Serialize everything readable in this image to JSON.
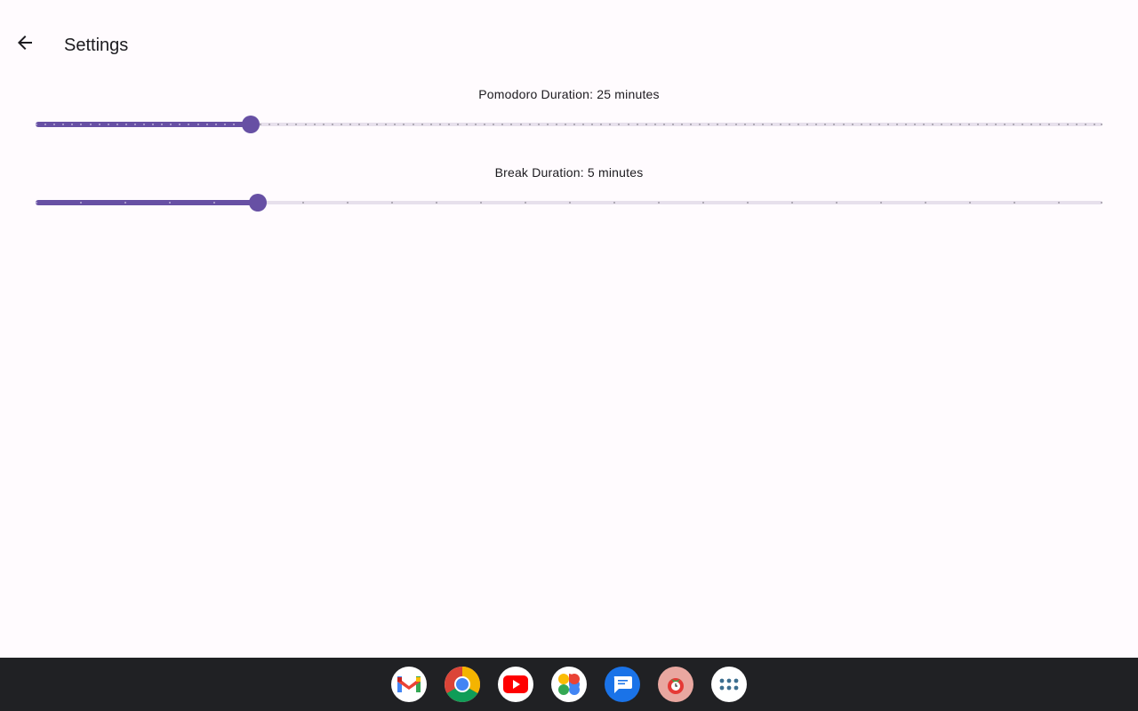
{
  "header": {
    "title": "Settings",
    "back_icon": "arrow-back-icon"
  },
  "settings": {
    "pomodoro": {
      "label": "Pomodoro Duration: 25 minutes",
      "value": 25,
      "min": 1,
      "max": 120,
      "divisions": 119
    },
    "break": {
      "label": "Break Duration: 5 minutes",
      "value": 5,
      "min": 0,
      "max": 24,
      "divisions": 24
    }
  },
  "colors": {
    "accent": "#6750a4",
    "track_inactive": "#e7e0ec",
    "background": "#fffbfe",
    "taskbar": "#202124"
  },
  "taskbar": {
    "apps": [
      {
        "name": "gmail-icon"
      },
      {
        "name": "chrome-icon"
      },
      {
        "name": "youtube-icon"
      },
      {
        "name": "photos-icon"
      },
      {
        "name": "messages-icon"
      },
      {
        "name": "tomato-app-icon"
      },
      {
        "name": "app-launcher-icon"
      }
    ]
  }
}
